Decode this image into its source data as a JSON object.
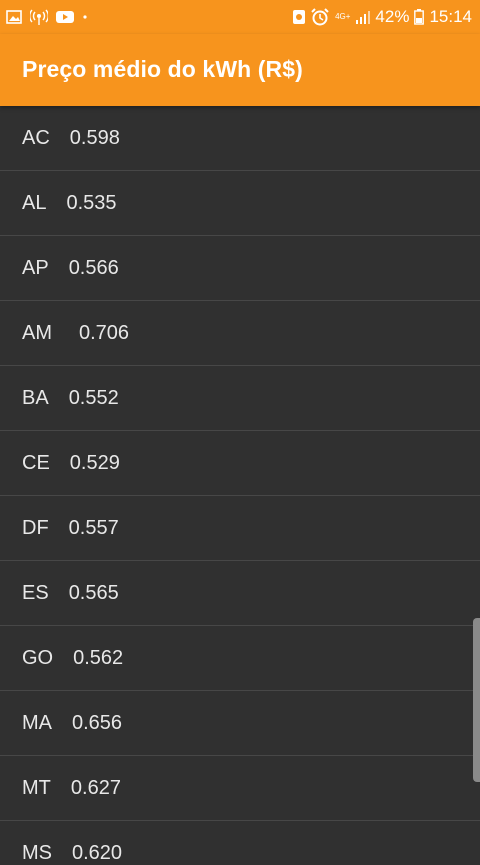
{
  "status_bar": {
    "left_icons": [
      "image-icon",
      "antenna-icon",
      "youtube-icon",
      "dot-icon"
    ],
    "network": "4G+",
    "battery": "42%",
    "time": "15:14"
  },
  "app_bar": {
    "title": "Preço médio do kWh (R$)"
  },
  "rows": [
    {
      "state": "AC",
      "price": "0.598"
    },
    {
      "state": "AL",
      "price": "0.535"
    },
    {
      "state": "AP",
      "price": "0.566"
    },
    {
      "state": "AM",
      "price": "0.706"
    },
    {
      "state": "BA",
      "price": "0.552"
    },
    {
      "state": "CE",
      "price": "0.529"
    },
    {
      "state": "DF",
      "price": "0.557"
    },
    {
      "state": "ES",
      "price": "0.565"
    },
    {
      "state": "GO",
      "price": "0.562"
    },
    {
      "state": "MA",
      "price": "0.656"
    },
    {
      "state": "MT",
      "price": "0.627"
    },
    {
      "state": "MS",
      "price": "0.620"
    }
  ]
}
